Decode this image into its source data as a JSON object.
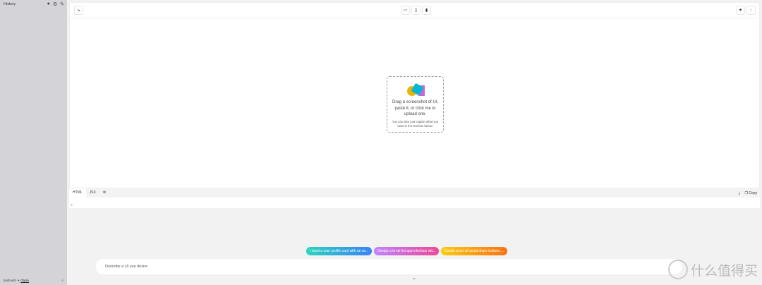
{
  "sidebar": {
    "title": "History",
    "footer_prefix": "Built with",
    "footer_link": "Glaze",
    "collapse": "«"
  },
  "dropzone": {
    "title": "Drag a screenshot of UI, paste it, or click me to upload one.",
    "subtitle": "You can also just explain what you want in the text box below."
  },
  "code_panel": {
    "tabs": [
      "HTML",
      "JSX"
    ],
    "copy_label": "Copy",
    "line_marker": "«"
  },
  "suggestions": [
    {
      "label": "I need a user profile card with an av...",
      "from": "#2dd4bf",
      "to": "#3b82f6"
    },
    {
      "label": "Design a to-do list app interface wit...",
      "from": "#c084fc",
      "to": "#ec4899"
    },
    {
      "label": "Create a set of social share buttons ...",
      "from": "#facc15",
      "to": "#f97316"
    }
  ],
  "prompt": {
    "placeholder": "Describe a UI you desire"
  },
  "watermark": "什么值得买"
}
